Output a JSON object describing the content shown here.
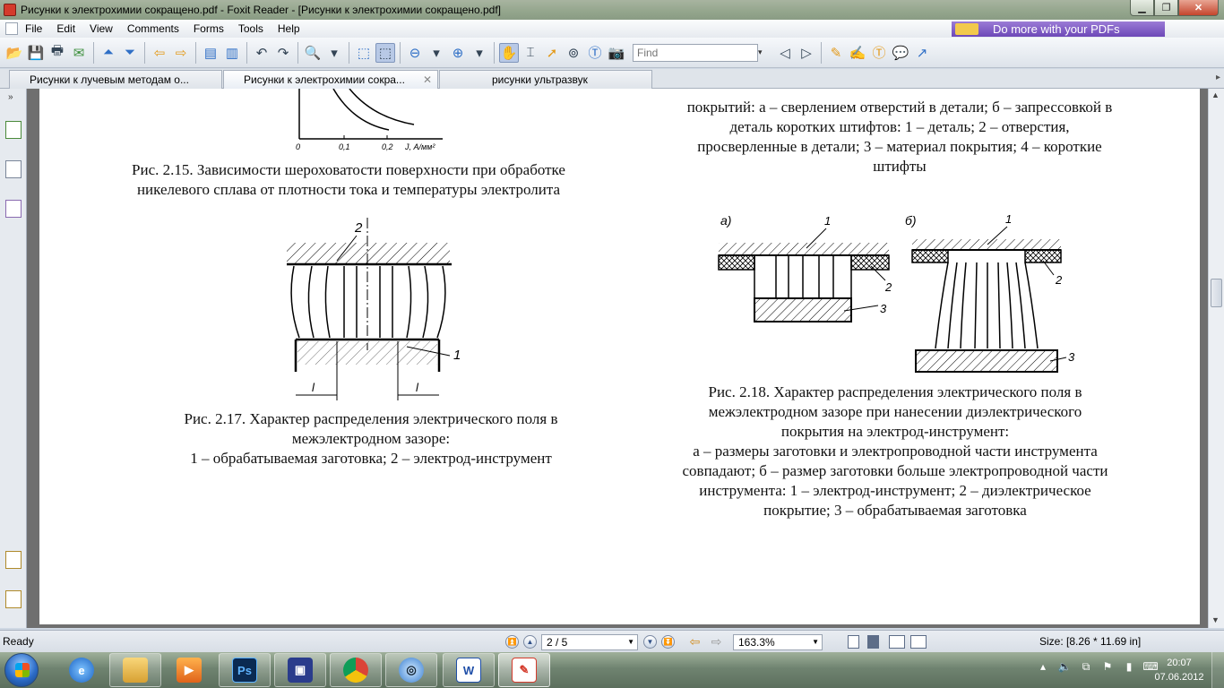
{
  "window": {
    "title": "Рисунки к электрохимии сокращено.pdf - Foxit Reader - [Рисунки к электрохимии сокращено.pdf]",
    "minimize": "▁",
    "maximize": "❐",
    "close": "✕"
  },
  "menu": {
    "items": [
      "File",
      "Edit",
      "View",
      "Comments",
      "Forms",
      "Tools",
      "Help"
    ],
    "promo": "Do more with your PDFs"
  },
  "toolbar": {
    "find_placeholder": "Find"
  },
  "tabs": [
    {
      "label": "Рисунки к лучевым методам о..."
    },
    {
      "label": "Рисунки к электрохимии сокра...",
      "close": "✕"
    },
    {
      "label": "рисунки ультразвук"
    }
  ],
  "document": {
    "fig215": {
      "tick_0": "0",
      "tick_01": "0,1",
      "tick_02": "0,2",
      "axis_label": "J, А/мм²",
      "caption_line1": "Рис. 2.15. Зависимости шероховатости поверхности при обработке",
      "caption_line2": "никелевого сплава от плотности тока и температуры электролита"
    },
    "fig216": {
      "line1": "покрытий: а – сверлением отверстий в детали; б – запрессовкой в",
      "line2": "деталь коротких штифтов: 1 – деталь; 2 – отверстия,",
      "line3": "просверленные в детали;  3 – материал покрытия; 4 – короткие",
      "line4": "штифты"
    },
    "fig217": {
      "label_1": "1",
      "label_2": "2",
      "label_l": "l",
      "caption_line1": "Рис. 2.17. Характер распределения электрического поля в",
      "caption_line2": "межэлектродном зазоре:",
      "caption_line3": "1 – обрабатываемая заготовка; 2 – электрод-инструмент"
    },
    "fig218": {
      "label_a": "а)",
      "label_b": "б)",
      "label_1": "1",
      "label_2": "2",
      "label_3": "3",
      "caption_line1": "Рис. 2.18. Характер распределения электрического поля в",
      "caption_line2": "межэлектродном зазоре при нанесении диэлектрического",
      "caption_line3": "покрытия на электрод-инструмент:",
      "caption_line4": "а – размеры заготовки и электропроводной части инструмента",
      "caption_line5": "совпадают; б – размер заготовки больше электропроводной части",
      "caption_line6": "инструмента: 1 – электрод-инструмент; 2 – диэлектрическое",
      "caption_line7": "покрытие; 3 – обрабатываемая заготовка"
    }
  },
  "status": {
    "ready": "Ready",
    "page": "2 / 5",
    "zoom": "163.3%",
    "size": "Size: [8.26 * 11.69 in]"
  },
  "taskbar": {
    "clock_time": "20:07",
    "clock_date": "07.06.2012",
    "ps_label": "Ps",
    "word_label": "W"
  }
}
